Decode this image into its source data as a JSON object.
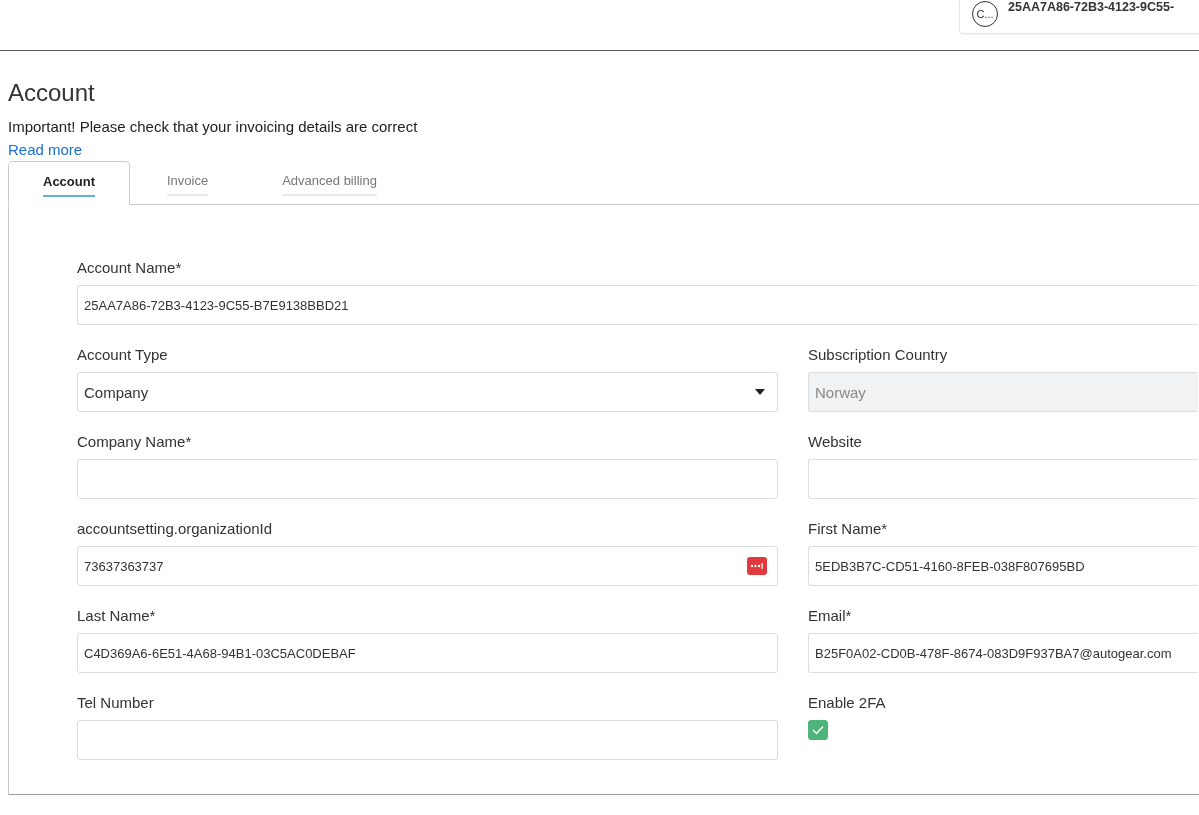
{
  "header": {
    "user": {
      "avatar": "C...",
      "name": "25AA7A86-72B3-4123-9C55-"
    }
  },
  "page": {
    "title": "Account",
    "notice": "Important! Please check that your invoicing details are correct",
    "link": "Read more"
  },
  "tabs": [
    {
      "label": "Account",
      "selected": true
    },
    {
      "label": "Invoice",
      "selected": false
    },
    {
      "label": "Advanced billing",
      "selected": false
    }
  ],
  "account_name": {
    "label": "Account Name*",
    "value": "25AA7A86-72B3-4123-9C55-B7E9138BBD21"
  },
  "fields": [
    {
      "kind": "select",
      "label": "Account Type",
      "value": "Company",
      "disabled": false
    },
    {
      "kind": "text",
      "label": "Subscription Country",
      "value": "Norway",
      "disabled": true
    },
    {
      "kind": "text",
      "label": "Company Name*",
      "disabled": false
    },
    {
      "kind": "text",
      "label": "Website",
      "disabled": false
    },
    {
      "kind": "password",
      "label": "accountsetting.organizationId",
      "value": "73637363737",
      "disabled": false
    },
    {
      "kind": "text",
      "label": "First Name*",
      "value": "5EDB3B7C-CD51-4160-8FEB-038F807695BD",
      "disabled": false
    },
    {
      "kind": "text",
      "label": "Last Name*",
      "value": "C4D369A6-6E51-4A68-94B1-03C5AC0DEBAF",
      "disabled": false
    },
    {
      "kind": "text",
      "label": "Email*",
      "value": "B25F0A02-CD0B-478F-8674-083D9F937BA7@autogear.com",
      "disabled": false
    },
    {
      "kind": "text",
      "label": "Tel Number",
      "disabled": false
    },
    {
      "kind": "checkbox",
      "label": "Enable 2FA",
      "checked": true
    }
  ]
}
